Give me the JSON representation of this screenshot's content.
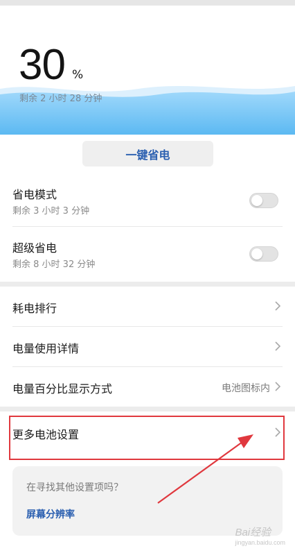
{
  "battery": {
    "percent": "30",
    "unit": "%",
    "remaining": "剩余 2 小时 28 分钟"
  },
  "power_saving": {
    "one_key_label": "一键省电",
    "modes": [
      {
        "title": "省电模式",
        "remaining": "剩余 3 小时 3 分钟",
        "enabled": false
      },
      {
        "title": "超级省电",
        "remaining": "剩余 8 小时 32 分钟",
        "enabled": false
      }
    ]
  },
  "list": {
    "items": [
      {
        "label": "耗电排行",
        "value": ""
      },
      {
        "label": "电量使用详情",
        "value": ""
      },
      {
        "label": "电量百分比显示方式",
        "value": "电池图标内"
      }
    ]
  },
  "more": {
    "label": "更多电池设置"
  },
  "suggest": {
    "question": "在寻找其他设置项吗？",
    "link": "屏幕分辨率"
  },
  "watermark": {
    "text": "Bai经验",
    "sub": "jingyan.baidu.com"
  },
  "colors": {
    "accent": "#2a5fb0",
    "wave": "#6ec3f5",
    "highlight": "#e0383e"
  },
  "icons": {
    "chevron": "chevron-right-icon"
  }
}
